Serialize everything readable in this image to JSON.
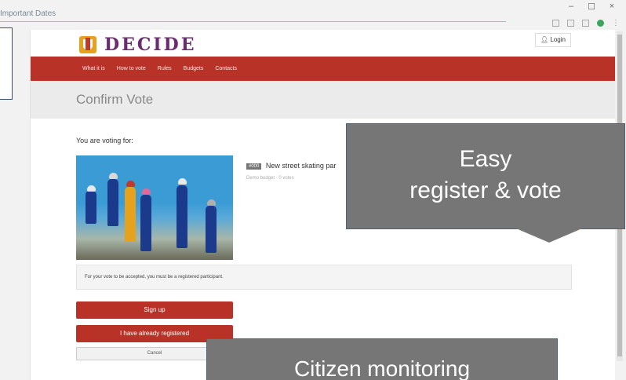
{
  "tab": {
    "title": "Important Dates"
  },
  "window": {
    "minimize": "–",
    "maximize": "☐",
    "close": "×"
  },
  "site": {
    "logo_text": "DECIDE",
    "login_label": "Login"
  },
  "nav": {
    "items": [
      "What it is",
      "How to vote",
      "Rules",
      "Budgets",
      "Contacts"
    ]
  },
  "page": {
    "title": "Confirm Vote",
    "voting_label": "You are voting for:"
  },
  "proposal": {
    "badge": "#000",
    "title": "New street skating par",
    "meta": "Demo budget · 0 votes"
  },
  "notice": "For your vote to be accepted, you must be a registered participant.",
  "buttons": {
    "signup": "Sign up",
    "registered": "I have already registered",
    "cancel": "Cancel"
  },
  "callouts": {
    "easy_line1": "Easy",
    "easy_line2": "register & vote",
    "monitor": "Citizen monitoring"
  },
  "colors": {
    "brand_red": "#b83228",
    "logo_purple": "#6a2c6e",
    "callout_gray": "#767676"
  }
}
